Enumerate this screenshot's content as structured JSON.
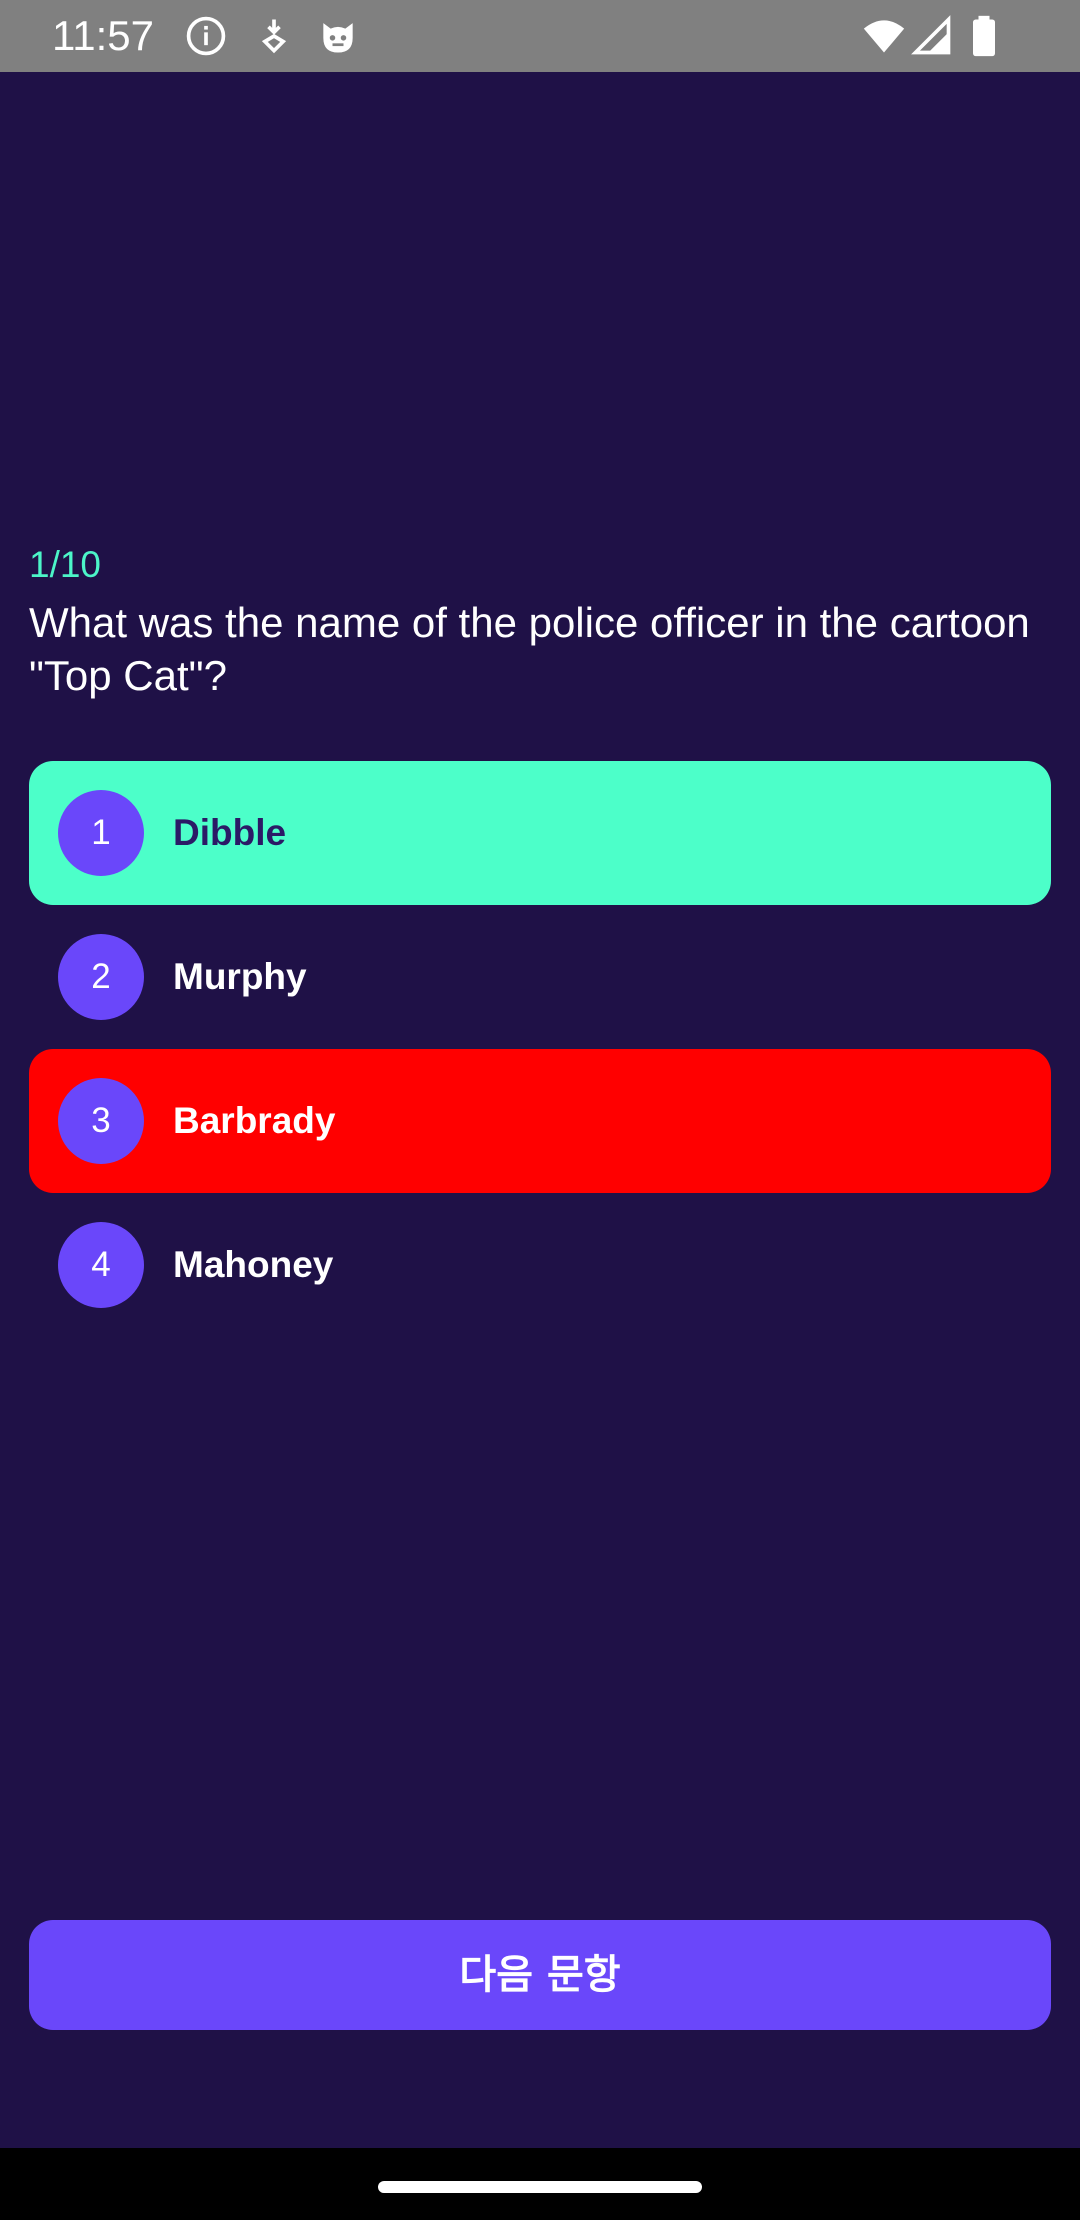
{
  "status_bar": {
    "time": "11:57",
    "left_icons": [
      "info-icon",
      "location-arrow-icon",
      "cat-face-icon"
    ],
    "right_icons": [
      "wifi-icon",
      "cell-signal-icon",
      "battery-icon"
    ]
  },
  "quiz": {
    "progress": "1/10",
    "question": "What was the name of the police officer in the cartoon \"Top Cat\"?",
    "options": [
      {
        "number": "1",
        "label": "Dibble",
        "state": "correct"
      },
      {
        "number": "2",
        "label": "Murphy",
        "state": "neutral"
      },
      {
        "number": "3",
        "label": "Barbrady",
        "state": "wrong"
      },
      {
        "number": "4",
        "label": "Mahoney",
        "state": "neutral"
      }
    ],
    "next_label": "다음 문항"
  },
  "colors": {
    "background": "#1f1147",
    "accent": "#6a47fa",
    "correct": "#4cffc9",
    "wrong": "#ff0000",
    "progress_text": "#4cf5c8"
  }
}
